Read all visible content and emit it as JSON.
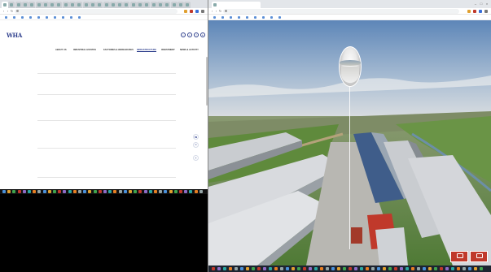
{
  "left_window": {
    "tabs": [
      "",
      "",
      "",
      "",
      "",
      "",
      "",
      "",
      "",
      "",
      "",
      "",
      "",
      "",
      "",
      "",
      "",
      "",
      "",
      "",
      "",
      "",
      "",
      "",
      "",
      "",
      "",
      ""
    ],
    "url": "",
    "bookmarks": [
      "",
      "",
      "",
      "",
      "",
      "",
      "",
      "",
      "",
      ""
    ]
  },
  "right_window": {
    "tab_title": "",
    "url": "",
    "bookmarks": [
      "",
      "",
      "",
      "",
      "",
      "",
      "",
      "",
      ""
    ]
  },
  "site": {
    "logo": "WHA",
    "logo_sub": "",
    "top_nav": [
      "",
      "",
      "",
      ""
    ],
    "main_nav": [
      "ABOUT US",
      "INDUSTRIAL ESTATES",
      "FACTORIES & WAREHOUSES",
      "INFRASTRUCTURE",
      "INVESTMENT",
      "NEWS & ACTIVITY"
    ],
    "active_nav_index": 3,
    "rows": [
      {
        "title": "",
        "subtitle": "",
        "status": "",
        "link": "",
        "link2": ""
      },
      {
        "title": "",
        "subtitle": "",
        "status": "",
        "link": "",
        "link2": ""
      },
      {
        "title": "",
        "subtitle": "",
        "status": "",
        "link": "",
        "link2": ""
      },
      {
        "title": "",
        "subtitle": "",
        "status": "",
        "link": "",
        "link2": ""
      },
      {
        "title": "",
        "subtitle": "",
        "status": "",
        "link": "",
        "link2": ""
      }
    ]
  },
  "aerial": {
    "corner_left": "",
    "corner_right": ""
  },
  "colors": {
    "brand": "#2d3e8c",
    "corner_red": "#c0392b"
  }
}
